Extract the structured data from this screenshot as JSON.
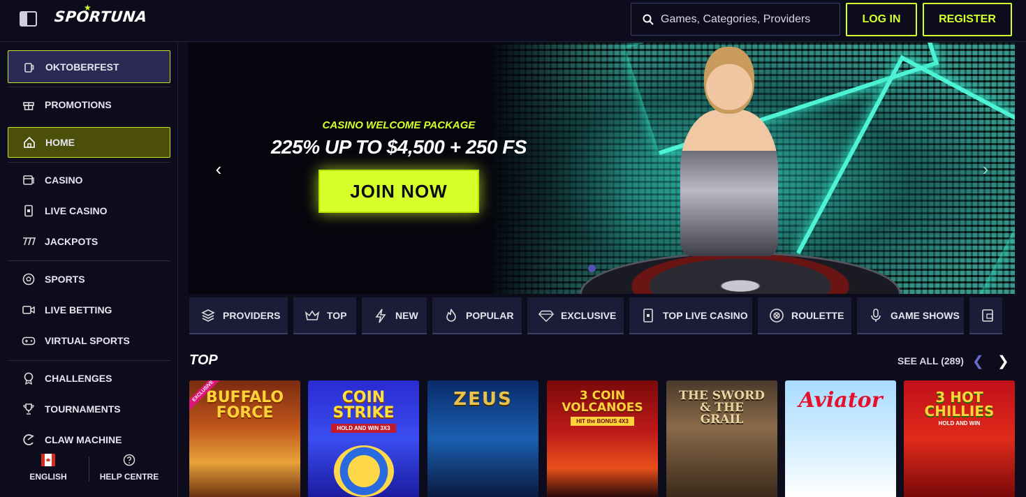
{
  "header": {
    "logo_text": "SPORTUNA",
    "search_placeholder": "Games, Categories, Providers",
    "login_label": "LOG IN",
    "register_label": "REGISTER",
    "accent_color": "#d7ff2a"
  },
  "sidebar": {
    "items": [
      {
        "label": "OKTOBERFEST",
        "icon": "beer-mug-icon"
      },
      {
        "label": "PROMOTIONS",
        "icon": "gift-icon"
      },
      {
        "label": "HOME",
        "icon": "home-icon"
      },
      {
        "label": "CASINO",
        "icon": "casino-icon"
      },
      {
        "label": "LIVE CASINO",
        "icon": "live-casino-icon"
      },
      {
        "label": "JACKPOTS",
        "icon": "jackpot-icon"
      },
      {
        "label": "SPORTS",
        "icon": "soccer-ball-icon"
      },
      {
        "label": "LIVE BETTING",
        "icon": "video-camera-icon"
      },
      {
        "label": "VIRTUAL SPORTS",
        "icon": "gamepad-icon"
      },
      {
        "label": "CHALLENGES",
        "icon": "medal-icon"
      },
      {
        "label": "TOURNAMENTS",
        "icon": "trophy-icon"
      },
      {
        "label": "CLAW MACHINE",
        "icon": "claw-icon"
      }
    ],
    "footer": {
      "language_label": "ENGLISH",
      "help_label": "HELP CENTRE"
    }
  },
  "hero": {
    "subtitle": "CASINO WELCOME PACKAGE",
    "title": "225% UP TO $4,500 + 250 FS",
    "cta_label": "JOIN NOW"
  },
  "categories": [
    {
      "label": "PROVIDERS",
      "icon": "layers-icon"
    },
    {
      "label": "TOP",
      "icon": "crown-icon"
    },
    {
      "label": "NEW",
      "icon": "lightning-icon"
    },
    {
      "label": "POPULAR",
      "icon": "flame-icon"
    },
    {
      "label": "EXCLUSIVE",
      "icon": "diamond-icon"
    },
    {
      "label": "TOP LIVE CASINO",
      "icon": "phone-card-icon"
    },
    {
      "label": "ROULETTE",
      "icon": "roulette-icon"
    },
    {
      "label": "GAME SHOWS",
      "icon": "microphone-icon"
    }
  ],
  "top_section": {
    "title": "TOP",
    "see_all_label": "SEE ALL (289)",
    "games": [
      {
        "name": "BUFFALO FORCE",
        "badge": "EXCLUSIVE"
      },
      {
        "name": "COIN STRIKE",
        "subtitle": "HOLD AND WIN 3X3"
      },
      {
        "name": "ZEUS"
      },
      {
        "name": "3 COIN VOLCANOES",
        "subtitle": "HIT the BONUS 4X3"
      },
      {
        "name": "THE SWORD & THE GRAIL"
      },
      {
        "name": "Aviator"
      },
      {
        "name": "3 HOT CHILLIES",
        "subtitle": "HOLD AND WIN"
      }
    ]
  }
}
